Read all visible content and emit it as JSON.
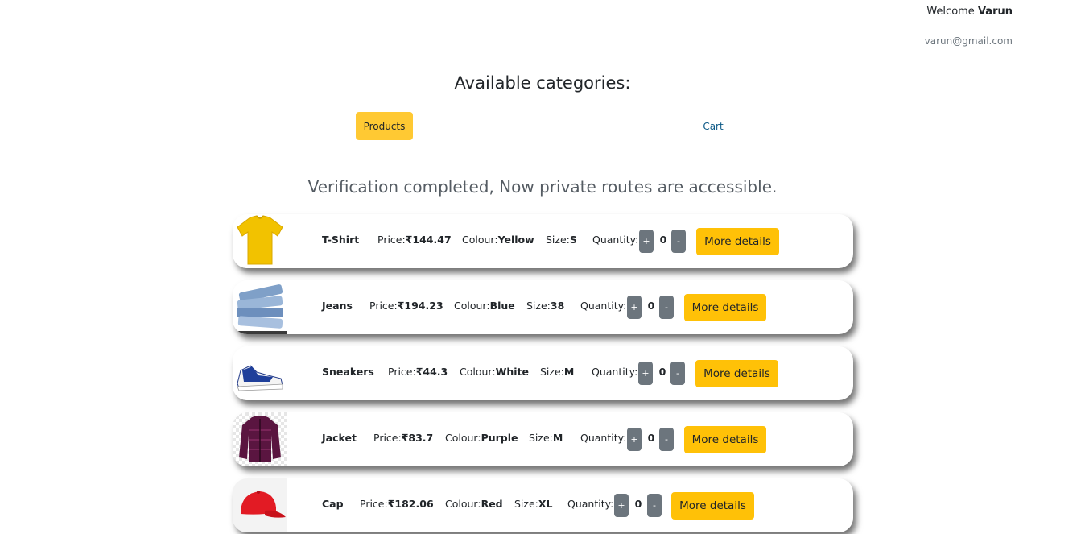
{
  "user": {
    "welcome_prefix": "Welcome",
    "name": "Varun",
    "email": "varun@gmail.com"
  },
  "categories": {
    "title": "Available categories:",
    "products_label": "Products",
    "cart_label": "Cart"
  },
  "message": "Verification completed, Now private routes are accessible.",
  "labels": {
    "price": "Price:",
    "colour": "Colour:",
    "size": "Size:",
    "quantity": "Quantity:",
    "plus": "+",
    "minus": "-",
    "more_details": "More details"
  },
  "products": [
    {
      "name": "T-Shirt",
      "price": "₹144.47",
      "colour": "Yellow",
      "size": "S",
      "quantity": "0",
      "image": "t-shirt-image"
    },
    {
      "name": "Jeans",
      "price": "₹194.23",
      "colour": "Blue",
      "size": "38",
      "quantity": "0",
      "image": "jeans-image"
    },
    {
      "name": "Sneakers",
      "price": "₹44.3",
      "colour": "White",
      "size": "M",
      "quantity": "0",
      "image": "sneakers-image"
    },
    {
      "name": "Jacket",
      "price": "₹83.7",
      "colour": "Purple",
      "size": "M",
      "quantity": "0",
      "image": "jacket-image"
    },
    {
      "name": "Cap",
      "price": "₹182.06",
      "colour": "Red",
      "size": "XL",
      "quantity": "0",
      "image": "cap-image"
    }
  ],
  "colors": {
    "accent": "#ffc107",
    "active_tab": "#ffc933",
    "qty_button": "#6c757d",
    "link": "#0d5a87"
  }
}
